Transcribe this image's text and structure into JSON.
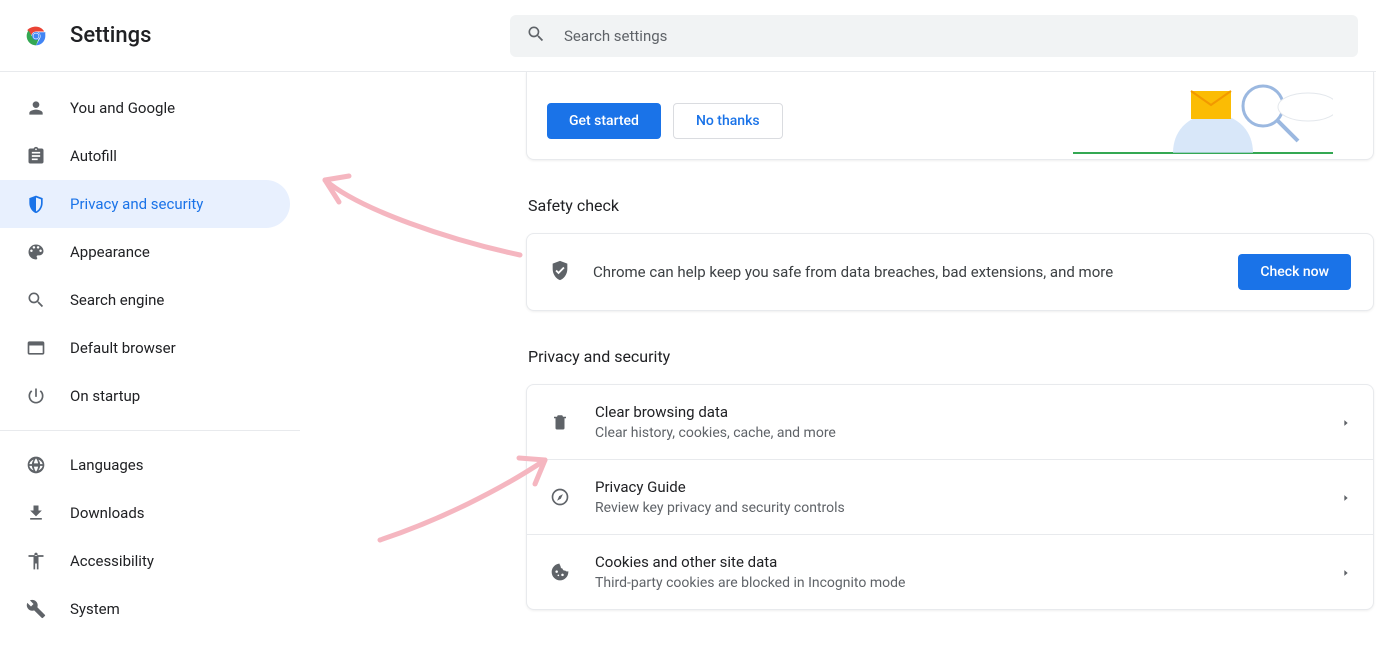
{
  "header": {
    "title": "Settings",
    "search_placeholder": "Search settings"
  },
  "sidebar": {
    "groups": [
      {
        "items": [
          {
            "id": "you-and-google",
            "label": "You and Google",
            "icon": "person"
          },
          {
            "id": "autofill",
            "label": "Autofill",
            "icon": "clipboard"
          },
          {
            "id": "privacy-and-security",
            "label": "Privacy and security",
            "icon": "shield",
            "active": true
          },
          {
            "id": "appearance",
            "label": "Appearance",
            "icon": "palette"
          },
          {
            "id": "search-engine",
            "label": "Search engine",
            "icon": "search"
          },
          {
            "id": "default-browser",
            "label": "Default browser",
            "icon": "browser"
          },
          {
            "id": "on-startup",
            "label": "On startup",
            "icon": "power"
          }
        ]
      },
      {
        "items": [
          {
            "id": "languages",
            "label": "Languages",
            "icon": "globe"
          },
          {
            "id": "downloads",
            "label": "Downloads",
            "icon": "download"
          },
          {
            "id": "accessibility",
            "label": "Accessibility",
            "icon": "accessibility"
          },
          {
            "id": "system",
            "label": "System",
            "icon": "wrench"
          }
        ]
      }
    ]
  },
  "main": {
    "guide": {
      "get_started_label": "Get started",
      "no_thanks_label": "No thanks"
    },
    "safety": {
      "section_title": "Safety check",
      "text": "Chrome can help keep you safe from data breaches, bad extensions, and more",
      "check_label": "Check now"
    },
    "privacy": {
      "section_title": "Privacy and security",
      "rows": [
        {
          "id": "clear-browsing-data",
          "title": "Clear browsing data",
          "sub": "Clear history, cookies, cache, and more",
          "icon": "trash"
        },
        {
          "id": "privacy-guide",
          "title": "Privacy Guide",
          "sub": "Review key privacy and security controls",
          "icon": "compass"
        },
        {
          "id": "cookies",
          "title": "Cookies and other site data",
          "sub": "Third-party cookies are blocked in Incognito mode",
          "icon": "cookie"
        }
      ]
    }
  }
}
